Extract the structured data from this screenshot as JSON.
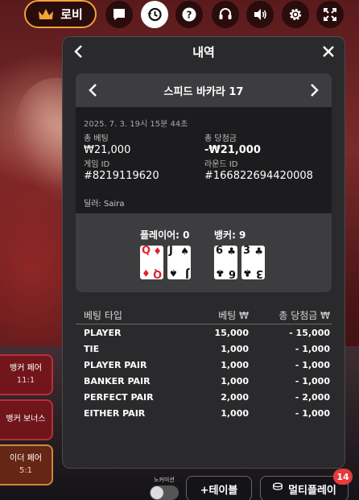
{
  "topbar": {
    "lobby_label": "로비",
    "icons": [
      "chat-icon",
      "history-icon",
      "help-icon",
      "headset-icon",
      "volume-icon",
      "settings-icon",
      "fullscreen-icon"
    ],
    "active_icon": "history-icon",
    "accent_color": "#f2a23a"
  },
  "panel": {
    "title": "내역"
  },
  "round": {
    "game_name": "스피드 바카라 17",
    "datetime": "2025. 7. 3. 19시 15분 44초",
    "total_bet_label": "총 베팅",
    "total_bet_value": "₩21,000",
    "total_win_label": "총 당첨금",
    "total_win_value": "-₩21,000",
    "game_id_label": "게임 ID",
    "game_id_value": "#8219119620",
    "round_id_label": "라운드 ID",
    "round_id_value": "#166822694420008",
    "dealer": "딜러: Saira"
  },
  "result": {
    "player_label": "플레이어: 0",
    "banker_label": "뱅커: 9",
    "player_cards": [
      {
        "rank": "Q",
        "suit": "♦",
        "color": "red"
      },
      {
        "rank": "J",
        "suit": "♠",
        "color": "black"
      }
    ],
    "banker_cards": [
      {
        "rank": "6",
        "suit": "♣",
        "color": "black"
      },
      {
        "rank": "3",
        "suit": "♣",
        "color": "black"
      }
    ]
  },
  "bets": {
    "headers": {
      "type": "베팅 타입",
      "bet": "베팅 ₩",
      "win": "총 당첨금 ₩"
    },
    "rows": [
      {
        "type": "PLAYER",
        "bet": "15,000",
        "win": "- 15,000"
      },
      {
        "type": "TIE",
        "bet": "1,000",
        "win": "- 1,000"
      },
      {
        "type": "PLAYER PAIR",
        "bet": "1,000",
        "win": "- 1,000"
      },
      {
        "type": "BANKER PAIR",
        "bet": "1,000",
        "win": "- 1,000"
      },
      {
        "type": "PERFECT PAIR",
        "bet": "2,000",
        "win": "- 2,000"
      },
      {
        "type": "EITHER PAIR",
        "bet": "1,000",
        "win": "- 1,000"
      }
    ]
  },
  "sidebets": [
    {
      "name": "뱅커 페어",
      "odds": "11:1"
    },
    {
      "name": "뱅커 보너스",
      "odds": ""
    },
    {
      "name": "이더 페어",
      "odds": "5:1"
    }
  ],
  "bottom": {
    "toggle_label": "노커미션",
    "add_table_label": "+테이블",
    "multiplay_label": "멀티플레이",
    "multiplay_badge": "14"
  }
}
